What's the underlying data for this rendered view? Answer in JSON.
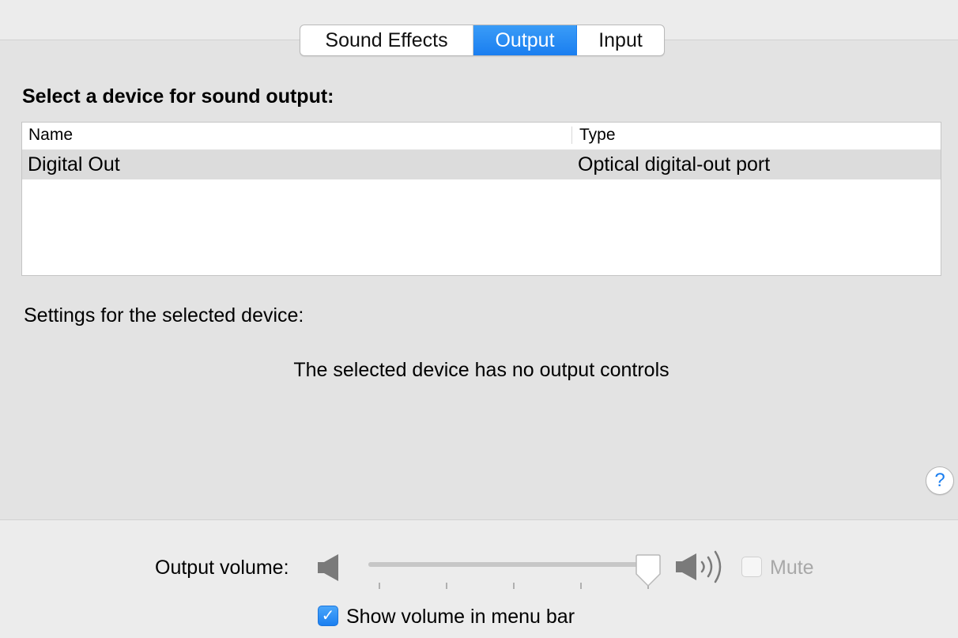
{
  "tabs": [
    {
      "label": "Sound Effects",
      "selected": false
    },
    {
      "label": "Output",
      "selected": true
    },
    {
      "label": "Input",
      "selected": false
    }
  ],
  "output": {
    "section_title": "Select a device for sound output:",
    "table": {
      "columns": [
        "Name",
        "Type"
      ],
      "rows": [
        {
          "name": "Digital Out",
          "type": "Optical digital-out port",
          "selected": true
        }
      ]
    },
    "settings_label": "Settings for the selected device:",
    "no_controls_message": "The selected device has no output controls"
  },
  "help": {
    "label": "?"
  },
  "volume": {
    "label": "Output volume:",
    "level_fraction": 0.95,
    "low_icon": "speaker-low-icon",
    "high_icon": "speaker-high-icon",
    "mute_label": "Mute",
    "mute_checked": false,
    "mute_enabled": false
  },
  "menu_bar": {
    "label": "Show volume in menu bar",
    "checked": true,
    "check_glyph": "✓"
  },
  "colors": {
    "accent": "#1a7ef0",
    "selected_row": "#dcdcdc",
    "disabled_text": "#a8a8a8"
  }
}
